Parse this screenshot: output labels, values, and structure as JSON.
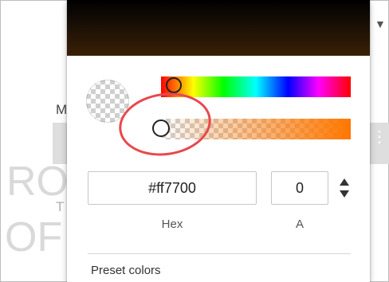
{
  "background": {
    "letters": [
      "M",
      "T"
    ]
  },
  "color_picker": {
    "current_color": "#ff7700",
    "hue_color": "#ff7700",
    "alpha_value": 0,
    "hex_value": "#ff7700",
    "alpha_input_value": "0",
    "hex_label": "Hex",
    "alpha_label": "A",
    "toggle_icon": "up-down-arrows-icon",
    "preset_title": "Preset colors",
    "highlight_color": "#e8484c"
  }
}
